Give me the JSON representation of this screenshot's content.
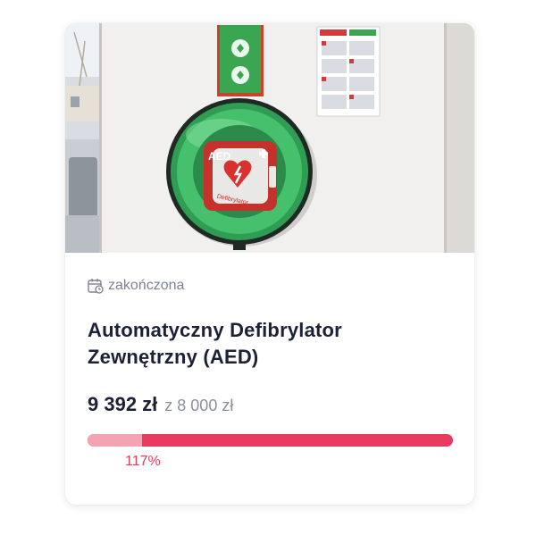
{
  "campaign": {
    "status": "zakończona",
    "status_icon": "calendar-clock-icon",
    "title_line1": "Automatyczny Defibrylator",
    "title_line2": "Zewnętrzny (AED)",
    "raised": "9 392 zł",
    "goal": "z 8 000 zł",
    "progress_percent_label": "117%",
    "progress_fraction": 1.174
  },
  "photo": {
    "aed_label": "AED",
    "brand_label": "Defibrylator"
  },
  "colors": {
    "accent": "#e63b5f",
    "accent_light": "#f3a3b2",
    "title": "#1c2136",
    "muted": "#7b8290"
  }
}
